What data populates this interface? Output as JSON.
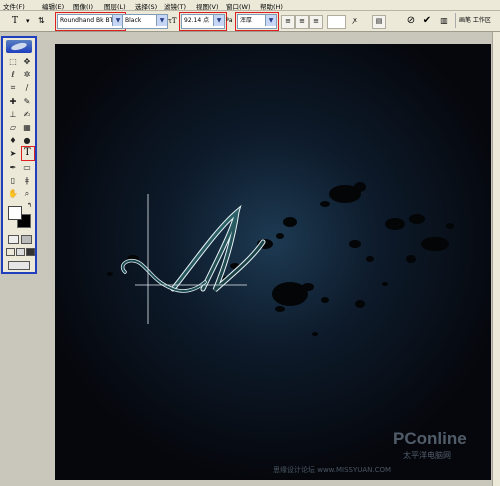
{
  "menubar": {
    "items": [
      "文件(F)",
      "编辑(E)",
      "图像(I)",
      "图层(L)",
      "选择(S)",
      "滤镜(T)",
      "视图(V)",
      "窗口(W)",
      "帮助(H)"
    ]
  },
  "options_bar": {
    "tool_icon": "T",
    "font_family": "Roundhand Bk BT",
    "font_style": "Black",
    "font_size": "92.14 点",
    "antialias": "浑厚",
    "workspace_tab": "画笔  工作区"
  },
  "toolbox": {
    "tools": [
      "marquee-tool",
      "move-tool",
      "lasso-tool",
      "magic-wand-tool",
      "crop-tool",
      "slice-tool",
      "healing-brush-tool",
      "brush-tool",
      "clone-stamp-tool",
      "history-brush-tool",
      "eraser-tool",
      "gradient-tool",
      "blur-tool",
      "dodge-tool",
      "path-selection-tool",
      "type-tool",
      "pen-tool",
      "shape-tool",
      "notes-tool",
      "eyedropper-tool",
      "hand-tool",
      "zoom-tool"
    ],
    "type_tool_label": "T"
  },
  "canvas": {
    "letter": "A",
    "watermark_brand": "PConline",
    "watermark_sub": "太平洋电脑网",
    "watermark_site": "思缘设计论坛 www.MISSYUAN.COM",
    "colors": {
      "bg": "#05070c",
      "glow": "#1d3a52",
      "letter_outline": "#e8f2f5",
      "letter_fill": "#1c4a52"
    }
  }
}
